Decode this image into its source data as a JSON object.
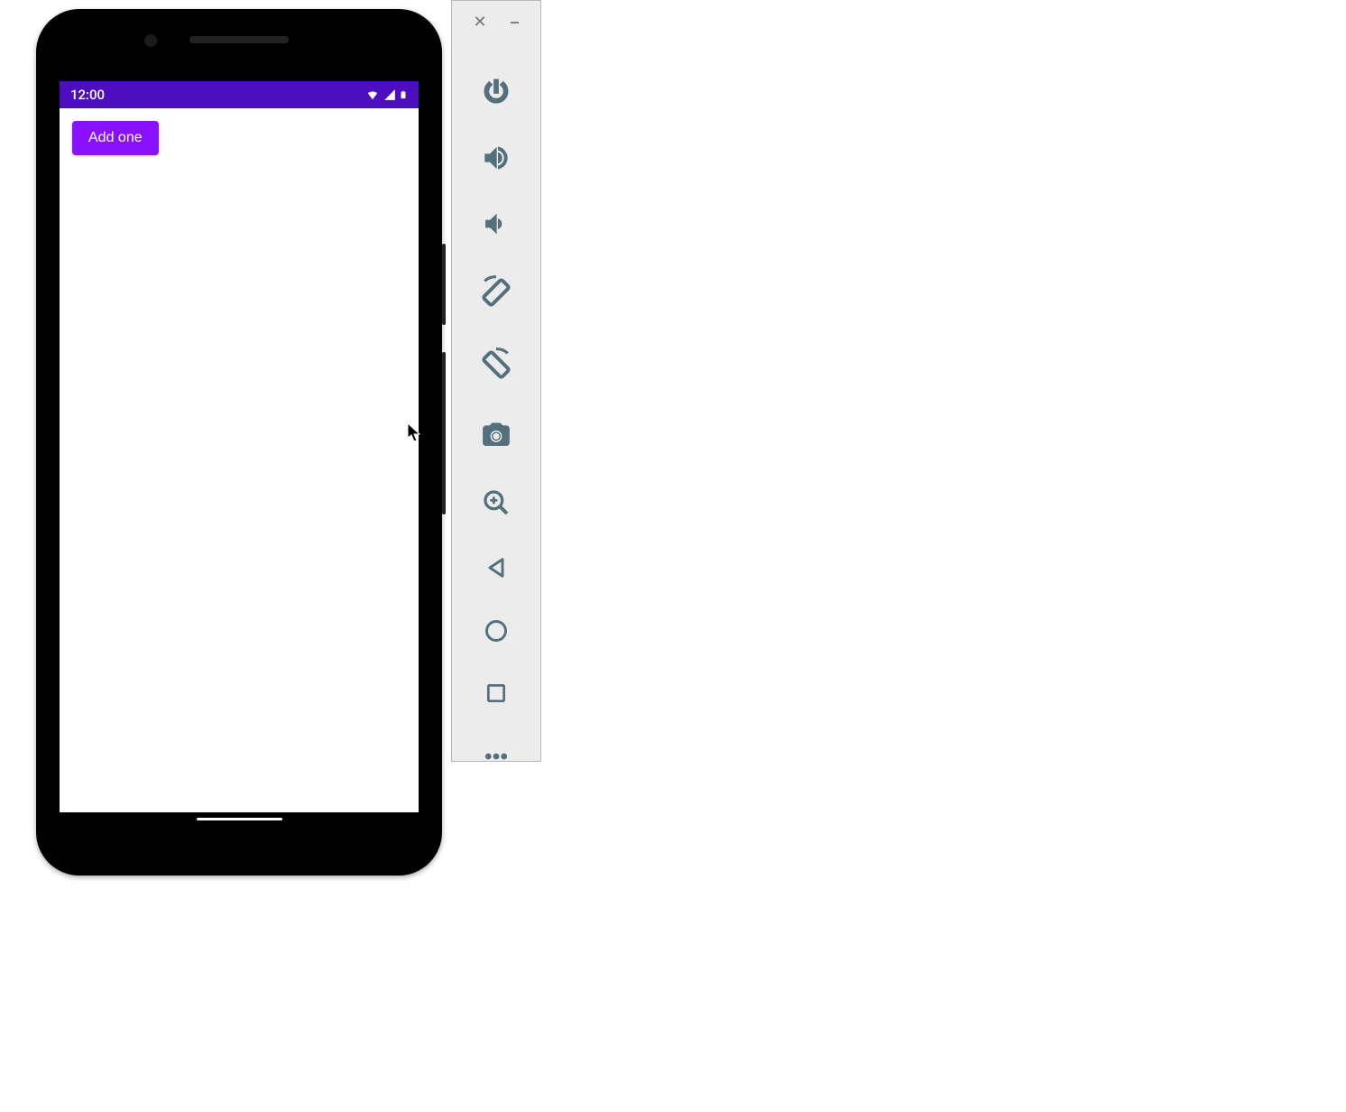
{
  "phone": {
    "status": {
      "time": "12:00"
    },
    "app": {
      "button_label": "Add one"
    }
  },
  "toolbar": {
    "close_title": "Close",
    "minimize_title": "Minimize",
    "items": [
      {
        "name": "power-icon",
        "label": "Power"
      },
      {
        "name": "volume-up-icon",
        "label": "Volume up"
      },
      {
        "name": "volume-down-icon",
        "label": "Volume down"
      },
      {
        "name": "rotate-left-icon",
        "label": "Rotate left"
      },
      {
        "name": "rotate-right-icon",
        "label": "Rotate right"
      },
      {
        "name": "screenshot-icon",
        "label": "Take screenshot"
      },
      {
        "name": "zoom-icon",
        "label": "Zoom"
      },
      {
        "name": "back-icon",
        "label": "Back"
      },
      {
        "name": "home-icon",
        "label": "Home"
      },
      {
        "name": "overview-icon",
        "label": "Overview"
      },
      {
        "name": "more-icon",
        "label": "More"
      }
    ]
  },
  "colors": {
    "accent": "#8a11ff",
    "status_bar": "#4d0ec0",
    "toolbar_icon": "#54707c"
  }
}
